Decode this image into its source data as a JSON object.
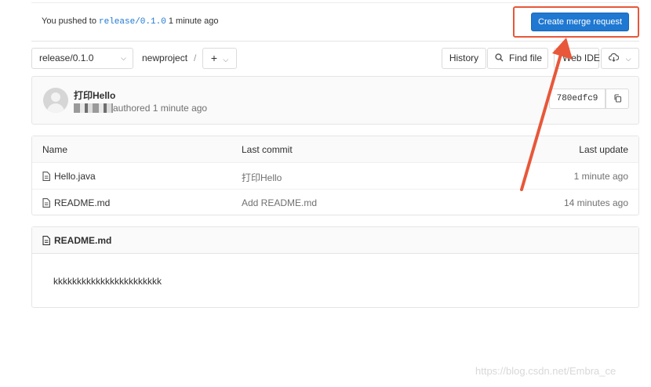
{
  "push_banner": {
    "text_before": "You pushed to ",
    "branch": "release/0.1.0",
    "text_after": " 1 minute ago",
    "merge_button": "Create merge request"
  },
  "toolbar": {
    "branch": "release/0.1.0",
    "project": "newproject",
    "separator": "/",
    "add_label": "+",
    "history": "History",
    "find_file": "Find file",
    "web_ide": "Web IDE"
  },
  "commit": {
    "title": "打印Hello",
    "meta": "authored 1 minute ago",
    "sha": "780edfc9"
  },
  "files": {
    "headers": {
      "name": "Name",
      "last_commit": "Last commit",
      "last_update": "Last update"
    },
    "rows": [
      {
        "name": "Hello.java",
        "commit": "打印Hello",
        "updated": "1 minute ago"
      },
      {
        "name": "README.md",
        "commit": "Add README.md",
        "updated": "14 minutes ago"
      }
    ]
  },
  "readme": {
    "title": "README.md",
    "content": "kkkkkkkkkkkkkkkkkkkkkkk"
  },
  "watermark": "https://blog.csdn.net/Embra_ce",
  "colors": {
    "accent": "#1f78d1",
    "annotation": "#e8573a"
  }
}
